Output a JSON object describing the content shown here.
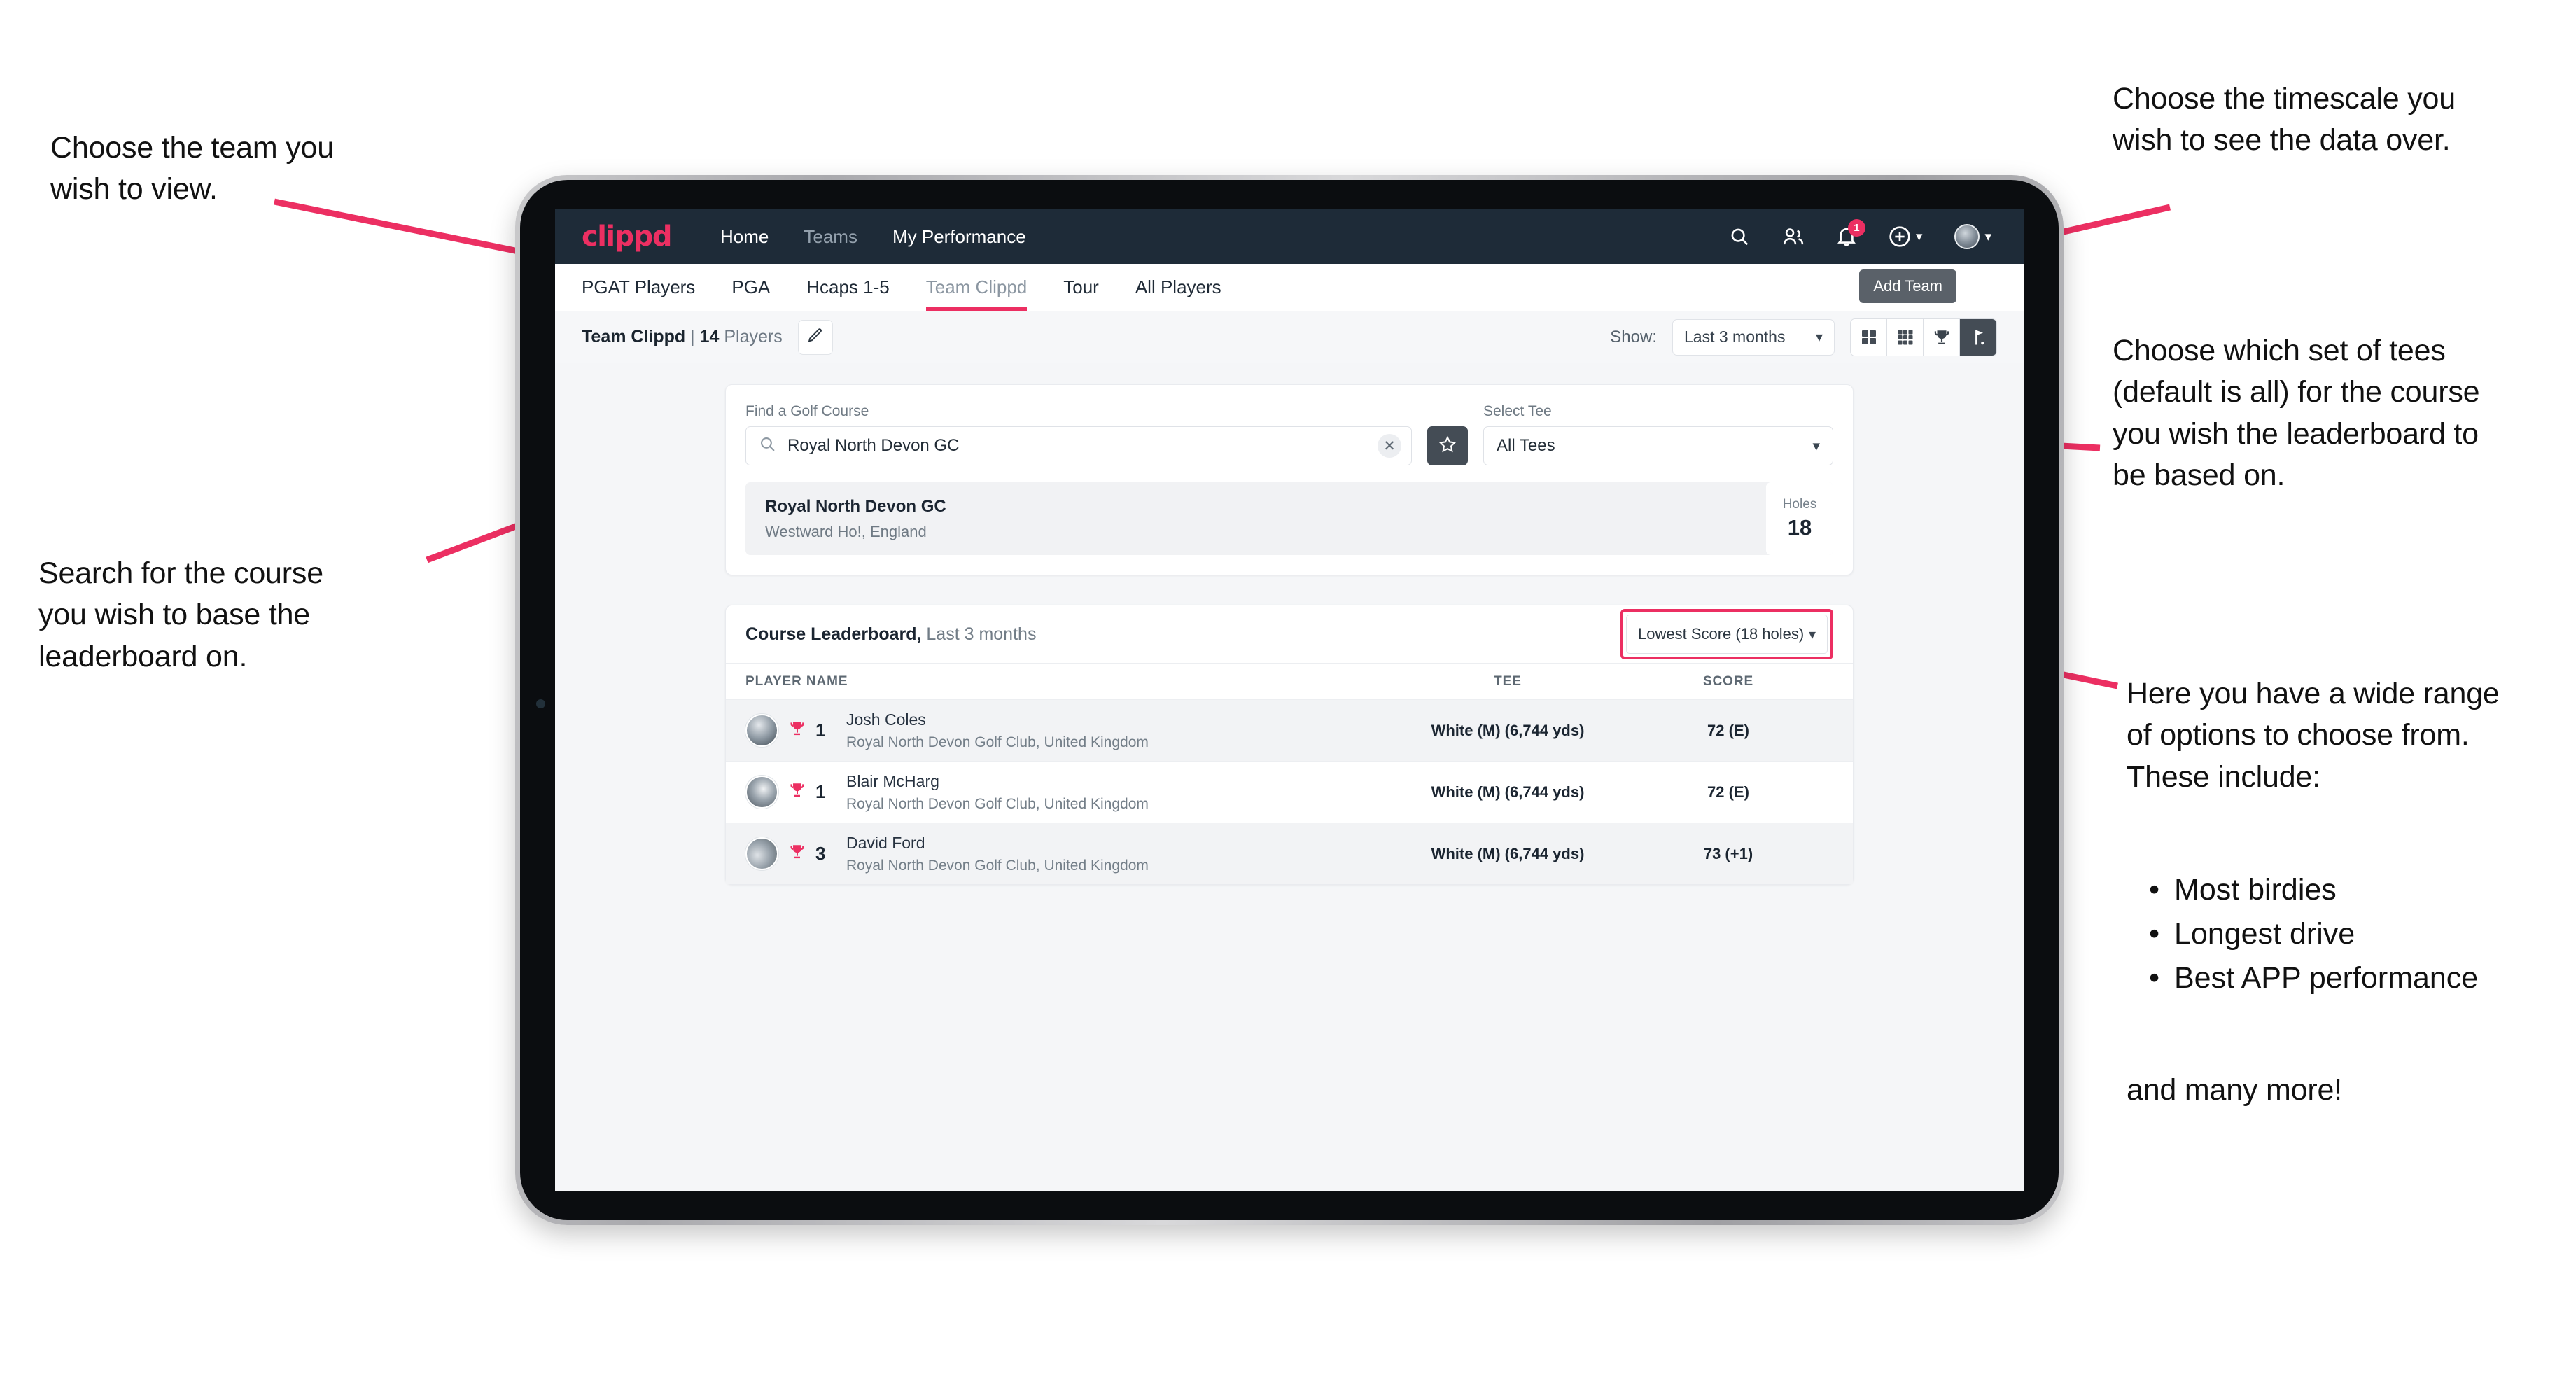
{
  "annotations": {
    "left_top": "Choose the team you\nwish to view.",
    "left_bottom": "Search for the course\nyou wish to base the\nleaderboard on.",
    "right_top": "Choose the timescale you\nwish to see the data over.",
    "right_tees": "Choose which set of tees\n(default is all) for the course\nyou wish the leaderboard to\nbe based on.",
    "right_options_intro": "Here you have a wide range\nof options to choose from.\nThese include:",
    "right_bullets": [
      "Most birdies",
      "Longest drive",
      "Best APP performance"
    ],
    "right_options_outro": "and many more!"
  },
  "topnav": {
    "logo": "clippd",
    "links": [
      {
        "label": "Home",
        "dim": false
      },
      {
        "label": "Teams",
        "dim": true
      },
      {
        "label": "My Performance",
        "dim": false
      }
    ],
    "icons": {
      "search": "search-icon",
      "people": "people-icon",
      "notifications": "bell-icon",
      "notification_count": "1",
      "add": "plus-circle-icon",
      "profile": "avatar-icon"
    }
  },
  "tooltip": {
    "label": "Add Team"
  },
  "tabs": [
    {
      "label": "PGAT Players",
      "state": "normal"
    },
    {
      "label": "PGA",
      "state": "normal"
    },
    {
      "label": "Hcaps 1-5",
      "state": "normal"
    },
    {
      "label": "Team Clippd",
      "state": "active"
    },
    {
      "label": "Tour",
      "state": "normal"
    },
    {
      "label": "All Players",
      "state": "normal"
    }
  ],
  "toolbar": {
    "team_name": "Team Clippd",
    "separator": "|",
    "player_count": "14",
    "players_word": "Players",
    "edit_icon": "pencil-icon",
    "show_label": "Show:",
    "timescale_value": "Last 3 months",
    "view_toggles": [
      {
        "name": "grid-2x2-view",
        "active": false
      },
      {
        "name": "grid-3x3-view",
        "active": false
      },
      {
        "name": "trophy-view",
        "active": false
      },
      {
        "name": "course-view",
        "active": true
      }
    ]
  },
  "search_panel": {
    "course_label": "Find a Golf Course",
    "course_value": "Royal North Devon GC",
    "course_placeholder": "Find a Golf Course",
    "clear_icon": "close-icon",
    "favourite_icon": "star-icon",
    "tee_label": "Select Tee",
    "tee_value": "All Tees"
  },
  "course_result": {
    "name": "Royal North Devon GC",
    "location": "Westward Ho!, England",
    "holes_label": "Holes",
    "holes_value": "18"
  },
  "leaderboard": {
    "title": "Course Leaderboard,",
    "subtitle": "Last 3 months",
    "sort_value": "Lowest Score (18 holes)",
    "columns": [
      "PLAYER NAME",
      "TEE",
      "SCORE"
    ],
    "rows": [
      {
        "rank": "1",
        "name": "Josh Coles",
        "club": "Royal North Devon Golf Club, United Kingdom",
        "tee": "White (M) (6,744 yds)",
        "score": "72 (E)"
      },
      {
        "rank": "1",
        "name": "Blair McHarg",
        "club": "Royal North Devon Golf Club, United Kingdom",
        "tee": "White (M) (6,744 yds)",
        "score": "72 (E)"
      },
      {
        "rank": "3",
        "name": "David Ford",
        "club": "Royal North Devon Golf Club, United Kingdom",
        "tee": "White (M) (6,744 yds)",
        "score": "73 (+1)"
      }
    ]
  },
  "colors": {
    "accent_pink": "#ec2f62",
    "nav_dark": "#1e2b38",
    "page_bg": "#f5f6f8",
    "toggle_active": "#444c55"
  }
}
